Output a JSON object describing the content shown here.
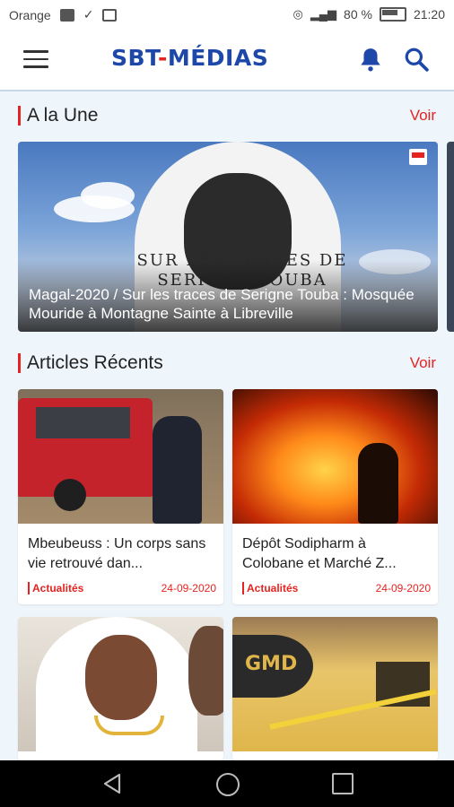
{
  "status_bar": {
    "carrier": "Orange",
    "battery_text": "80 %",
    "time": "21:20"
  },
  "app_bar": {
    "brand_left": "SBT",
    "brand_dash": "-",
    "brand_right": "MÉDIAS"
  },
  "a_la_une": {
    "title": "A la Une",
    "voir": "Voir",
    "featured": {
      "image_text": "SUR LES TRACES DE SERIGNE TOUBA",
      "caption": "Magal-2020 / Sur les traces de Serigne Touba : Mosquée Mouride à Montagne Sainte à Libreville"
    }
  },
  "articles_recents": {
    "title": "Articles Récents",
    "voir": "Voir",
    "cards": [
      {
        "title": "Mbeubeuss : Un corps sans vie retrouvé dan...",
        "category": "Actualités",
        "date": "24-09-2020"
      },
      {
        "title": "Dépôt Sodipharm à Colobane et Marché Z...",
        "category": "Actualités",
        "date": "24-09-2020"
      }
    ],
    "card_image_texts": {
      "gmd": "GMD"
    }
  },
  "colors": {
    "brand_blue": "#1d47a8",
    "accent_red": "#e52421",
    "page_background": "#eef5fb"
  },
  "icons": {
    "menu": "hamburger-icon",
    "notifications": "bell-icon",
    "search": "search-icon",
    "nav_back": "back-triangle-icon",
    "nav_home": "home-circle-icon",
    "nav_recent": "recent-square-icon"
  }
}
